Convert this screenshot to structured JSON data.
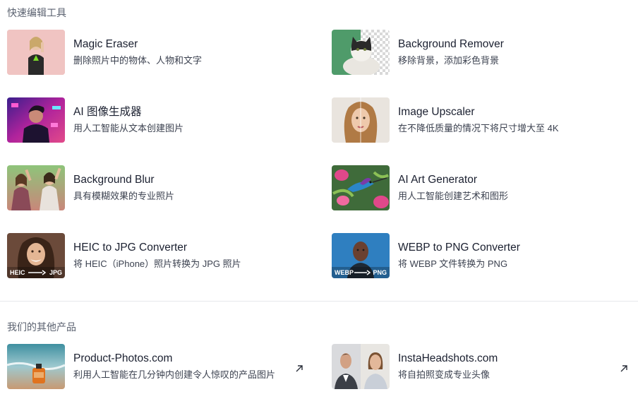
{
  "quick_tools": {
    "heading": "快速编辑工具",
    "items": [
      {
        "name": "Magic Eraser",
        "desc": "删除照片中的物体、人物和文字",
        "thumb": "woman-peace-sign-photo"
      },
      {
        "name": "Background Remover",
        "desc": "移除背景，添加彩色背景",
        "thumb": "cat-transparent-bg-photo"
      },
      {
        "name": "AI 图像生成器",
        "desc": "用人工智能从文本创建图片",
        "thumb": "neon-portrait-photo"
      },
      {
        "name": "Image Upscaler",
        "desc": "在不降低质量的情况下将尺寸增大至 4K",
        "thumb": "woman-face-photo"
      },
      {
        "name": "Background Blur",
        "desc": "具有模糊效果的专业照片",
        "thumb": "friends-festival-photo"
      },
      {
        "name": "AI Art Generator",
        "desc": "用人工智能创建艺术和图形",
        "thumb": "hummingbird-art"
      },
      {
        "name": "HEIC to JPG Converter",
        "desc": "将 HEIC（iPhone）照片转换为 JPG 照片",
        "thumb": "smiling-woman-photo",
        "from": "HEIC",
        "to": "JPG"
      },
      {
        "name": "WEBP to PNG Converter",
        "desc": "将 WEBP 文件转换为 PNG",
        "thumb": "man-blue-bg-photo",
        "from": "WEBP",
        "to": "PNG"
      }
    ]
  },
  "other_products": {
    "heading": "我们的其他产品",
    "items": [
      {
        "name": "Product-Photos.com",
        "desc": "利用人工智能在几分钟内创建令人惊叹的产品图片",
        "thumb": "perfume-beach-photo",
        "icon": "external-link-icon"
      },
      {
        "name": "InstaHeadshots.com",
        "desc": "将自拍照变成专业头像",
        "thumb": "headshots-photo",
        "icon": "external-link-icon"
      }
    ]
  },
  "colors": {
    "heading": "#5b6270",
    "title": "#1b2030",
    "desc": "#3c4250",
    "divider": "#e6e8ec"
  }
}
